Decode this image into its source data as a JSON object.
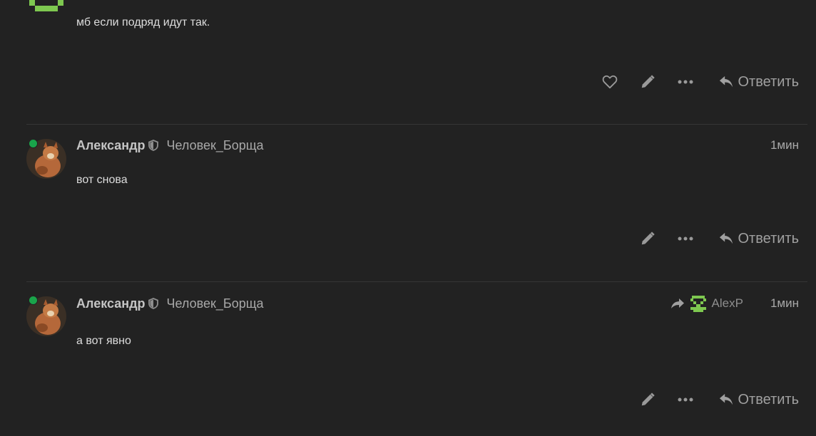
{
  "posts": [
    {
      "text": "мб если подряд идут так.",
      "actions": {
        "reply_label": "Ответить"
      }
    },
    {
      "username": "Александр",
      "title": "Человек_Борща",
      "time": "1мин",
      "text": "вот снова",
      "actions": {
        "reply_label": "Ответить"
      }
    },
    {
      "username": "Александр",
      "title": "Человек_Борща",
      "reply_to_user": "AlexP",
      "time": "1мин",
      "text": "а вот явно",
      "actions": {
        "reply_label": "Ответить"
      }
    }
  ],
  "colors": {
    "background": "#222222",
    "online": "#1aa44a",
    "pixel_avatar": "#7ec850"
  }
}
